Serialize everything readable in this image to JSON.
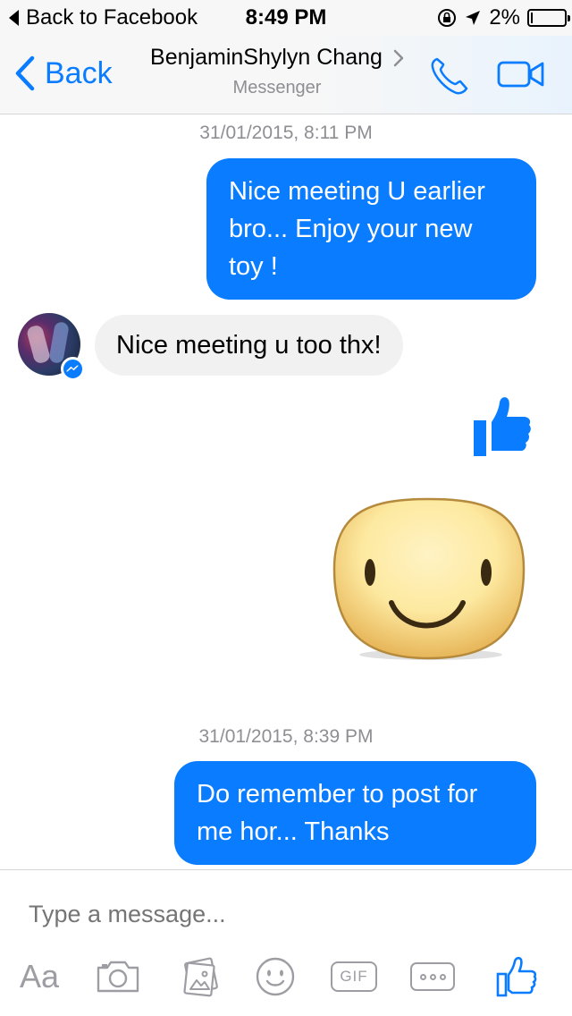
{
  "status_bar": {
    "back_label": "Back to Facebook",
    "time": "8:49 PM",
    "battery_percent": "2%",
    "battery_level": 0.02
  },
  "nav": {
    "back_label": "Back",
    "contact_name": "BenjaminShylyn Chang",
    "subtitle": "Messenger",
    "accent_color": "#0a7cff"
  },
  "messages": [
    {
      "type": "timestamp",
      "text": "31/01/2015, 8:11 PM"
    },
    {
      "type": "outgoing",
      "lines": [
        "Nice meeting U earlier",
        "bro... Enjoy your new",
        "toy !"
      ]
    },
    {
      "type": "incoming",
      "text": "Nice meeting u too thx!"
    },
    {
      "type": "outgoing-like",
      "icon": "thumbs-up-icon"
    },
    {
      "type": "outgoing-sticker",
      "icon": "smiley-sticker"
    },
    {
      "type": "timestamp",
      "text": "31/01/2015, 8:39 PM"
    },
    {
      "type": "outgoing",
      "lines": [
        "Do remember to post for",
        "me hor... Thanks"
      ]
    }
  ],
  "composer": {
    "placeholder": "Type a message...",
    "tools": {
      "text_label": "Aa",
      "gif_label": "GIF"
    }
  }
}
